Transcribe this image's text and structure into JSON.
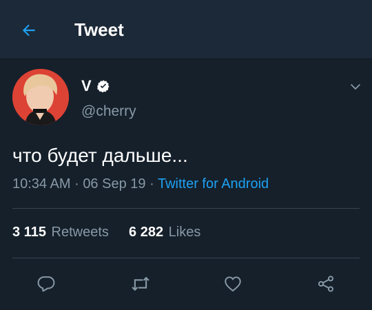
{
  "header": {
    "title": "Tweet",
    "back_icon": "arrow-left-icon"
  },
  "tweet": {
    "display_name": "V",
    "verified_icon": "verified-badge-icon",
    "handle": "@cherry",
    "text": "что будет дальше...",
    "time": "10:34 AM",
    "date": "06 Sep 19",
    "separator": "·",
    "source": "Twitter for Android",
    "retweets_count": "3 115",
    "retweets_label": "Retweets",
    "likes_count": "6 282",
    "likes_label": "Likes"
  },
  "actions": [
    "reply-icon",
    "retweet-icon",
    "like-icon",
    "share-icon"
  ],
  "colors": {
    "background": "#15202b",
    "header_background": "#1c2938",
    "accent": "#1da1f2",
    "secondary_text": "#8899a6",
    "divider": "#38444d"
  }
}
